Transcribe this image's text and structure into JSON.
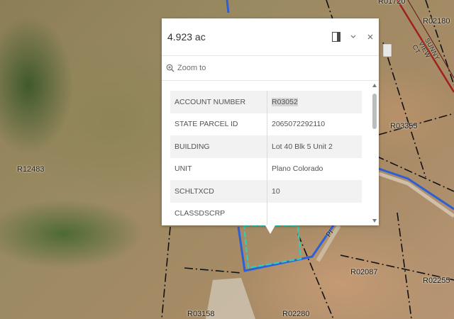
{
  "popup": {
    "title": "4.923 ac",
    "zoom_label": "Zoom to",
    "attributes": [
      {
        "key": "ACCOUNT NUMBER",
        "value": "R03052"
      },
      {
        "key": "STATE PARCEL ID",
        "value": "2065072292110"
      },
      {
        "key": "BUILDING",
        "value": "Lot 40 Blk 5 Unit 2"
      },
      {
        "key": "UNIT",
        "value": "Plano Colorado"
      },
      {
        "key": "SCHLTXCD",
        "value": "10"
      },
      {
        "key": "CLASSDSCRP",
        "value": ""
      }
    ],
    "icons": {
      "dock": "dock-icon",
      "collapse": "chevron-down-icon",
      "close": "close-icon",
      "zoom": "zoom-in-icon"
    }
  },
  "map": {
    "parcel_labels": [
      "R12483",
      "R03355",
      "R02180",
      "R02087",
      "R02255",
      "R03158",
      "R02280",
      "R01720"
    ],
    "road_labels": [
      "SUNNY VIEW CT",
      "PI"
    ],
    "colors": {
      "parcel_lines": "#111111",
      "road_blue": "#2d5fd6",
      "road_red": "#a02020",
      "selection": "#2ad4b8"
    }
  }
}
